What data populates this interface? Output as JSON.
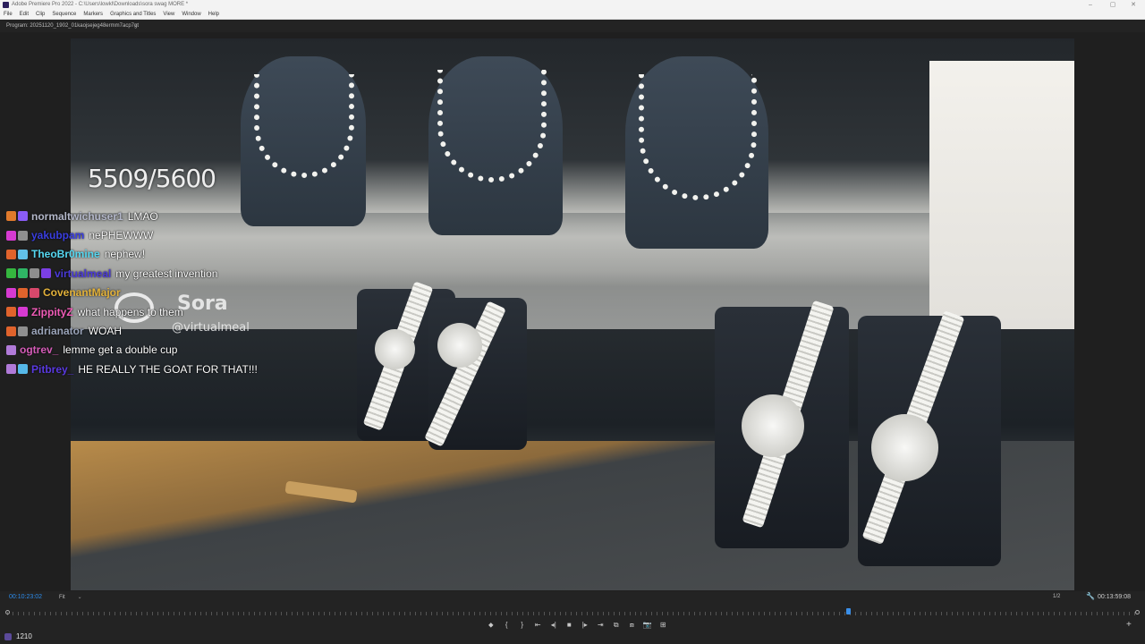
{
  "window": {
    "title": "Adobe Premiere Pro 2022 - C:\\Users\\lowkl\\Downloads\\sora swag MORE *",
    "controls": [
      "–",
      "▢",
      "✕"
    ]
  },
  "menu": [
    "File",
    "Edit",
    "Clip",
    "Sequence",
    "Markers",
    "Graphics and Titles",
    "View",
    "Window",
    "Help"
  ],
  "panel": {
    "title": "Program: 20251120_1902_01kaojsejeg48ermm7acp7gt",
    "menu_icon": "≡"
  },
  "overlay": {
    "counter": "5509/5600",
    "watermark_name": "Sora",
    "watermark_handle": "@virtualmeal"
  },
  "chat": [
    {
      "user": "normaltwichuser1",
      "message": "LMAO",
      "color": "#b3b7c9",
      "badges": [
        "#e07a2c",
        "#8a5cf6"
      ]
    },
    {
      "user": "yakubpam",
      "message": "nePHEWWW",
      "color": "#3a3ee0",
      "badges": [
        "#d63ad1",
        "#8f8f8f"
      ]
    },
    {
      "user": "TheoBr0mine",
      "message": "nephew!",
      "color": "#55d7f0",
      "badges": [
        "#e0632c",
        "#62c0e8"
      ]
    },
    {
      "user": "virtualmeal",
      "message": "my greatest invention",
      "color": "#4a3ad8",
      "badges": [
        "#35b73f",
        "#2fb565",
        "#8d8d8d",
        "#7b3fe4"
      ]
    },
    {
      "user": "CovenantMajor",
      "message": "",
      "color": "#e3b23a",
      "badges": [
        "#d63ad1",
        "#e0632c",
        "#d8486b"
      ]
    },
    {
      "user": "ZippityZ",
      "message": "what happens to them",
      "color": "#f05cb7",
      "badges": [
        "#e0632c",
        "#d63ad1"
      ]
    },
    {
      "user": "adrianator",
      "message": "WOAH",
      "color": "#9aa3b8",
      "badges": [
        "#e0632c",
        "#8f8f8f"
      ]
    },
    {
      "user": "ogtrev_",
      "message": "lemme get a double cup",
      "color": "#d55cb8",
      "badges": [
        "#b07ad8"
      ]
    },
    {
      "user": "Pitbrey_",
      "message": "HE REALLY THE GOAT FOR THAT!!!",
      "color": "#5a3ae0",
      "badges": [
        "#b07ad8",
        "#55b8e8"
      ]
    }
  ],
  "bottom": {
    "timecode_current": "00:10:23:02",
    "fit_label": "Fit",
    "quality": "1/2",
    "timecode_total": "00:13:59:08",
    "playhead_fraction": 0.742,
    "frame_count": "1210"
  },
  "transport": [
    "⬥",
    "{",
    "}",
    "⇤",
    "◂|",
    "■",
    "|▸",
    "⇥",
    "⧉",
    "⧈",
    "📷",
    "⊞"
  ],
  "add_button": "+"
}
